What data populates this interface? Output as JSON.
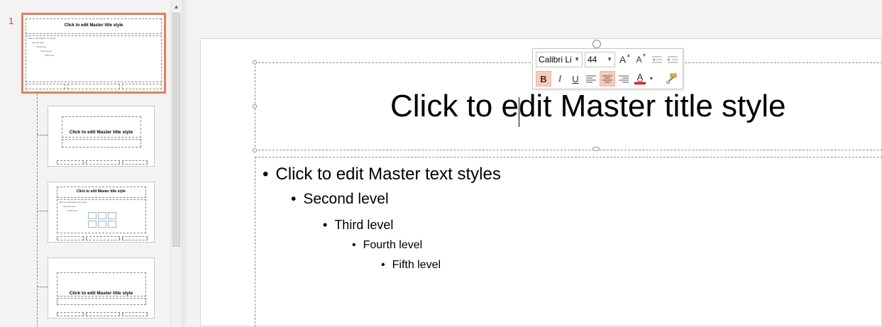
{
  "thumbnails": {
    "master_number": "1",
    "master_title": "Click to edit Master title style",
    "master_body": [
      "Click to edit Master text styles",
      "Second level",
      "Third level",
      "Fourth level",
      "Fifth level"
    ],
    "layout_titles": [
      "Click to edit Master title style",
      "Click to edit Master title style",
      "Click to edit Master title style"
    ],
    "layout_3_body": [
      "Click to edit Master text styles",
      "Second level",
      "Third level"
    ]
  },
  "slide": {
    "title": "Click to edit Master title style",
    "bullets": [
      {
        "level": 1,
        "text": "Click to edit Master text styles"
      },
      {
        "level": 2,
        "text": "Second level"
      },
      {
        "level": 3,
        "text": "Third level"
      },
      {
        "level": 4,
        "text": "Fourth level"
      },
      {
        "level": 5,
        "text": "Fifth level"
      }
    ]
  },
  "mini_toolbar": {
    "font_name": "Calibri Li",
    "font_size": "44",
    "grow_font": "A",
    "shrink_font": "A",
    "bold": "B",
    "italic": "I",
    "underline": "U",
    "font_color": "A",
    "icons": [
      "grow-font-icon",
      "shrink-font-icon",
      "decrease-indent-icon",
      "increase-indent-icon",
      "align-left-icon",
      "center-icon",
      "align-right-icon",
      "font-color-icon",
      "format-painter-icon"
    ]
  },
  "colors": {
    "selection_border": "#e97c5b",
    "active_button": "#f8cbb4",
    "font_color_bar": "#e00000",
    "accent_text": "#d24726"
  }
}
